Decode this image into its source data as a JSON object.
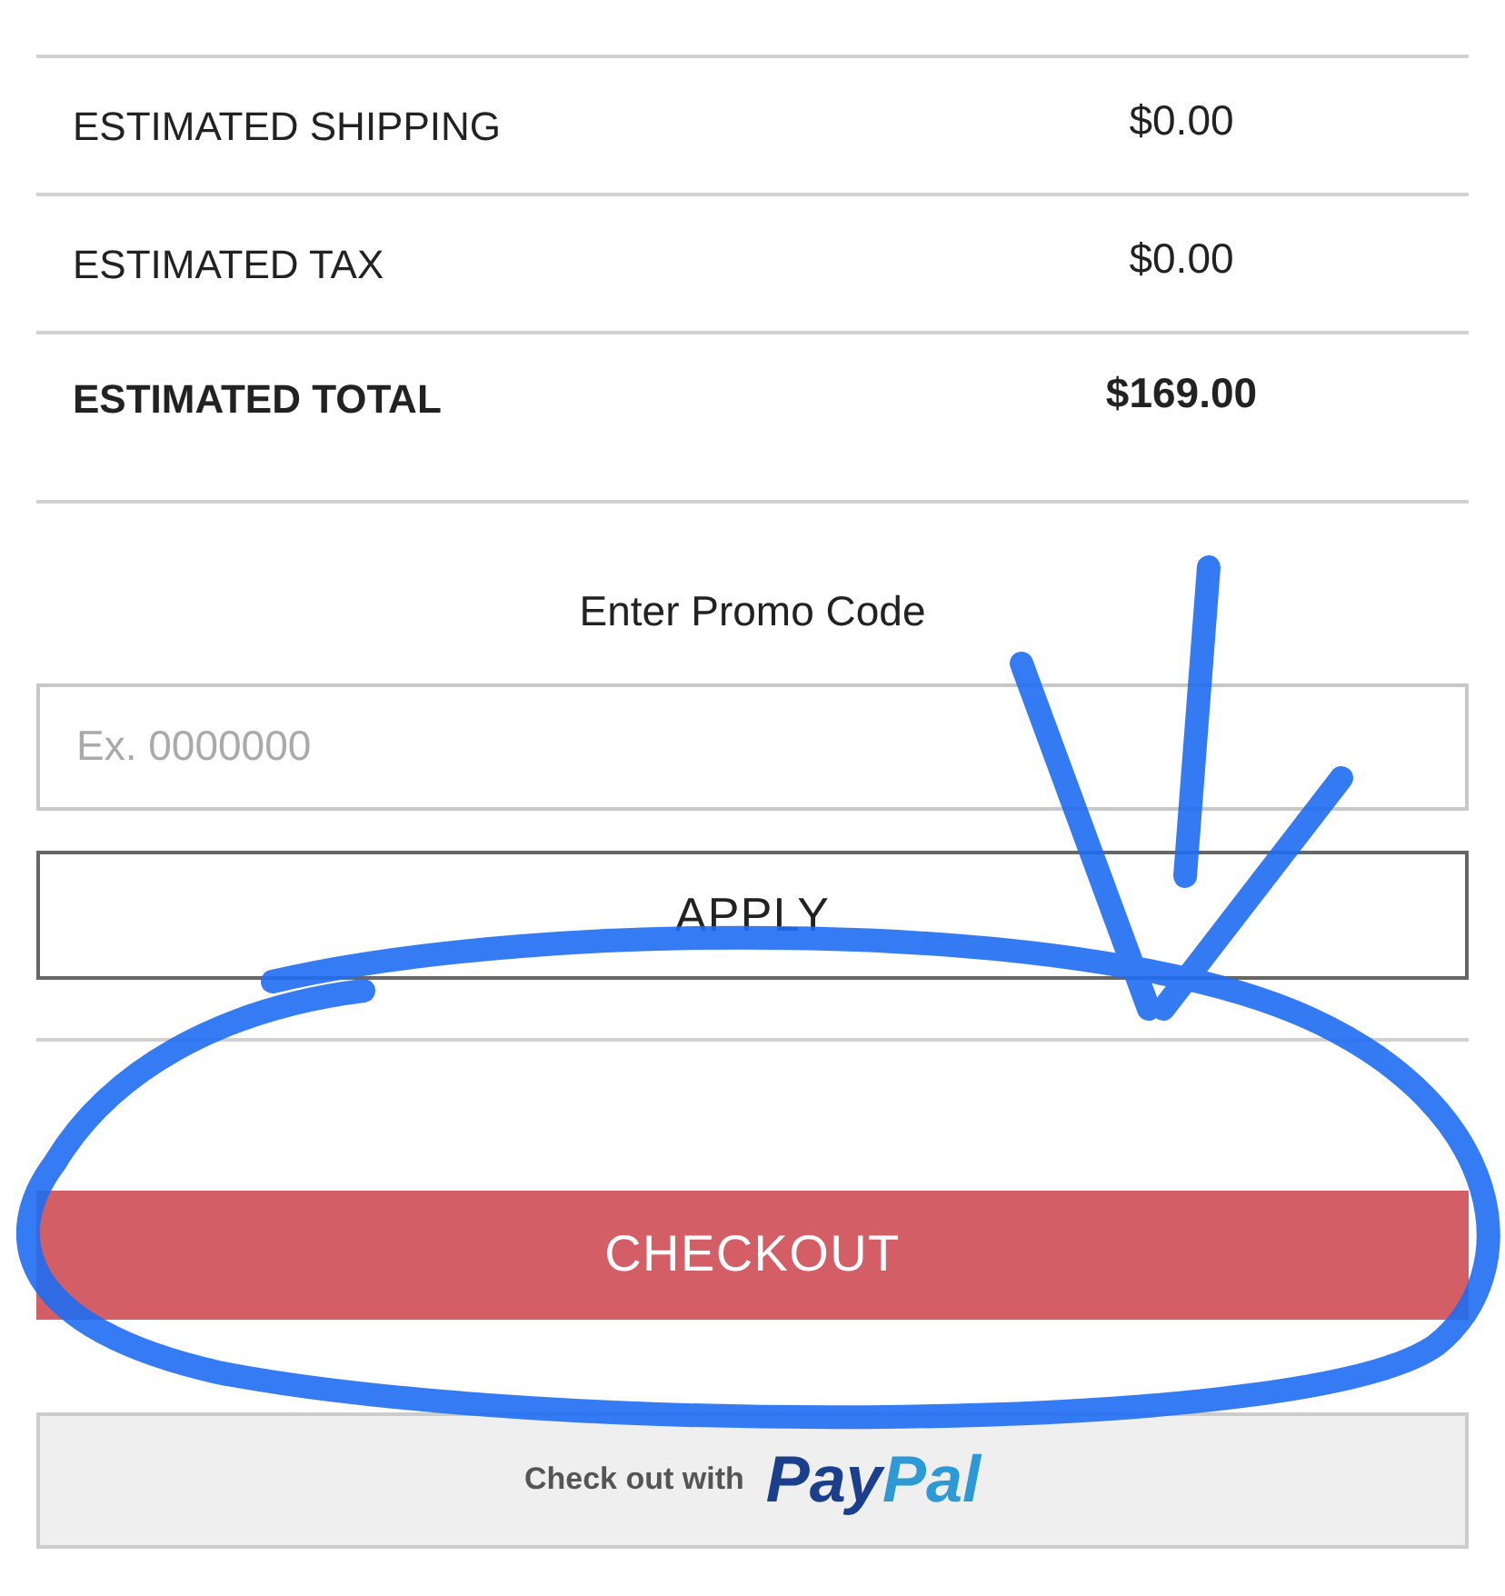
{
  "summary": {
    "rows": [
      {
        "label": "ESTIMATED SHIPPING",
        "value": "$0.00",
        "bold": false
      },
      {
        "label": "ESTIMATED TAX",
        "value": "$0.00",
        "bold": false
      },
      {
        "label": "ESTIMATED TOTAL",
        "value": "$169.00",
        "bold": true
      }
    ]
  },
  "promo": {
    "label": "Enter Promo Code",
    "placeholder": "Ex. 0000000",
    "apply_button": "APPLY"
  },
  "checkout_button": "CHECKOUT",
  "paypal_button": {
    "text": "Check out with",
    "logo": [
      "Pay",
      "Pal"
    ]
  }
}
